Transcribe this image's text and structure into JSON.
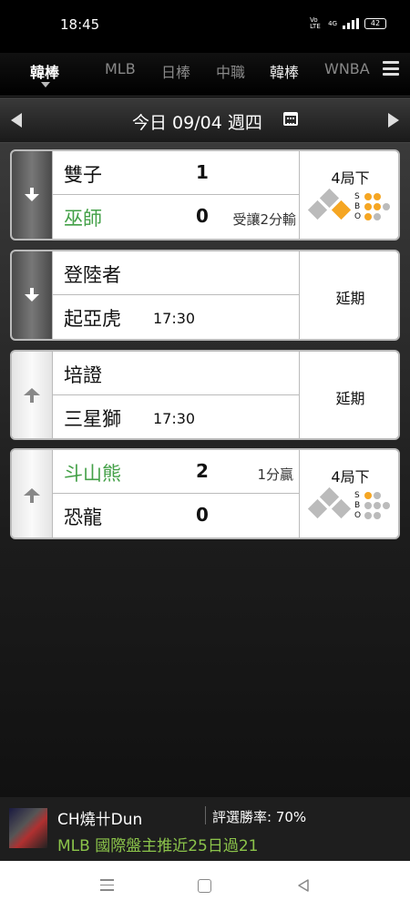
{
  "status_bar": {
    "time": "18:45",
    "network": "Vo LTE",
    "cellular": "4G",
    "battery": "42"
  },
  "tabs": [
    {
      "label": "韓棒",
      "active": true
    },
    {
      "label": "MLB"
    },
    {
      "label": "日棒"
    },
    {
      "label": "中職"
    },
    {
      "label": "韓棒"
    },
    {
      "label": "WNBA"
    }
  ],
  "date_bar": {
    "label": "今日 09/04 週四"
  },
  "games": [
    {
      "home": {
        "name": "雙子",
        "score": "1"
      },
      "away": {
        "name": "巫師",
        "score": "0",
        "note": "受讓2分輸"
      },
      "status": "4局下",
      "bases": {
        "first": false,
        "second": false,
        "third": true
      },
      "sbo": {
        "strikes": 1,
        "balls": 2,
        "outs": 1
      },
      "colors": {
        "accent_green": "#43a047",
        "base_on": "#f5a623"
      }
    },
    {
      "home": {
        "name": "登陸者"
      },
      "away": {
        "name": "起亞虎",
        "time": "17:30"
      },
      "status": "延期"
    },
    {
      "home": {
        "name": "培證"
      },
      "away": {
        "name": "三星獅",
        "time": "17:30"
      },
      "status": "延期"
    },
    {
      "home": {
        "name": "斗山熊",
        "score": "2",
        "note": "1分贏"
      },
      "away": {
        "name": "恐龍",
        "score": "0"
      },
      "status": "4局下",
      "sbo": {
        "strikes": 1,
        "balls": 0,
        "outs": 0
      }
    }
  ],
  "banner": {
    "name": "CH燒卄Dun",
    "rate_label": "評選勝率: 70%",
    "message": "MLB 國際盤主推近25日過21"
  }
}
